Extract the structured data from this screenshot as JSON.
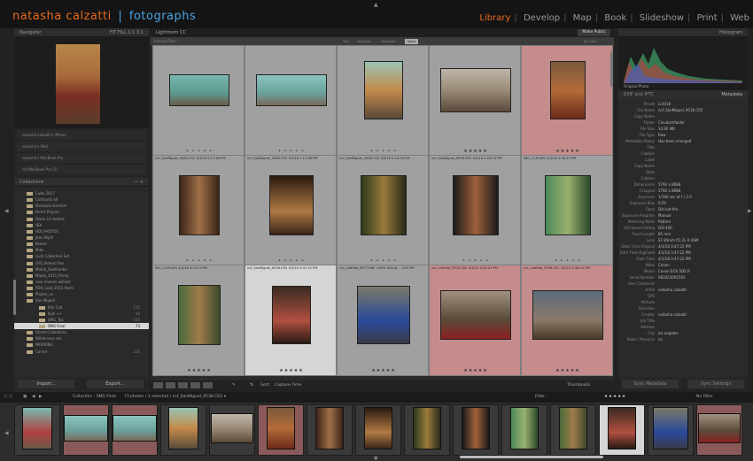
{
  "identity": {
    "brand_first": "natasha calzatti",
    "brand_separator": "|",
    "brand_second": "fotographs"
  },
  "modules": [
    "Library",
    "Develop",
    "Map",
    "Book",
    "Slideshow",
    "Print",
    "Web"
  ],
  "active_module": "Library",
  "navigator": {
    "title": "Navigator",
    "zoom_options": "FIT   FILL   1:1   3:1"
  },
  "publish": [
    "natasha calzatti's iPhone",
    "natasha's iPad",
    "natasha's MacBook Pro",
    "ncf MacBook Pro (2)"
  ],
  "collections": {
    "title": "Collections",
    "items": [
      {
        "name": "Cuba 2017",
        "count": ""
      },
      {
        "name": "Cultivarts olt",
        "count": ""
      },
      {
        "name": "Domaine Garmier",
        "count": ""
      },
      {
        "name": "Dvers Project",
        "count": ""
      },
      {
        "name": "Dwen Lil models",
        "count": ""
      },
      {
        "name": "HDI",
        "count": ""
      },
      {
        "name": "HDI_PHOTOS",
        "count": ""
      },
      {
        "name": "Jean Blyth",
        "count": ""
      },
      {
        "name": "Koerte",
        "count": ""
      },
      {
        "name": "Mike",
        "count": ""
      },
      {
        "name": "Loch Collection Set",
        "count": ""
      },
      {
        "name": "LRS_Videos files",
        "count": ""
      },
      {
        "name": "Mahdi_Seethimba",
        "count": ""
      },
      {
        "name": "Maple_2015_Primp",
        "count": ""
      },
      {
        "name": "new reverse william",
        "count": ""
      },
      {
        "name": "PDH_Look 2015 Posts",
        "count": ""
      },
      {
        "name": "Photos_sn",
        "count": ""
      },
      {
        "name": "San Miguel",
        "count": ""
      },
      {
        "name": "Kits Call",
        "count": "135"
      },
      {
        "name": "Kyle ++",
        "count": "48"
      },
      {
        "name": "SMG_Top",
        "count": "106"
      },
      {
        "name": "SMG Final",
        "count": "73"
      },
      {
        "name": "Street Collections",
        "count": ""
      },
      {
        "name": "Wilderness set",
        "count": ""
      },
      {
        "name": "WORKING",
        "count": ""
      },
      {
        "name": "Cornel",
        "count": "226"
      }
    ]
  },
  "buttons": {
    "import": "Import...",
    "export": "Export...",
    "make_public": "Make Public",
    "sync_metadata": "Sync Metadata",
    "sync_settings": "Sync Settings"
  },
  "center": {
    "title": "Lightroom CC",
    "filter_label": "Library Filter :",
    "filters": [
      "Text",
      "Attribute",
      "Metadata",
      "None"
    ],
    "active_filter": "None",
    "filter_preset": "No Filter"
  },
  "photos": [
    {
      "num": "",
      "file": "",
      "time": "",
      "stars": "•  •  •  •  •",
      "tone": "plain"
    },
    {
      "num": "",
      "file": "",
      "time": "",
      "stars": "•  •  •  •  •",
      "tone": "plain"
    },
    {
      "num": "",
      "file": "",
      "time": "",
      "stars": "•  •  •  •  •",
      "tone": "plain"
    },
    {
      "num": "",
      "file": "",
      "time": "",
      "stars": "★★★★★",
      "tone": "plain"
    },
    {
      "num": "",
      "file": "",
      "time": "",
      "stars": "★★★★★",
      "tone": "red"
    },
    {
      "num": "",
      "file": "ncf_SanMiguel_9464.CR2   4/3/18 2:17:46 PM",
      "time": "",
      "stars": "•  •  •  •  •",
      "tone": "plain"
    },
    {
      "num": "",
      "file": "ncf_SanMiguel_9464.CR2   4/3/18 2:17:48 PM",
      "time": "",
      "stars": "•  •  •  •  •",
      "tone": "plain"
    },
    {
      "num": "",
      "file": "ncf_SanMiguel_9498.CR2   4/3/18 2:24:34 PM",
      "time": "",
      "stars": "•  •  •  •  •",
      "tone": "plain"
    },
    {
      "num": "",
      "file": "ncf_SanMiguel_9508.CR2   4/3/18 2:25:14 PM",
      "time": "",
      "stars": "•  •  •  •  •",
      "tone": "plain"
    },
    {
      "num": "",
      "file": "IMG_1149.JPG   4/3/18 3:38:53 PM",
      "time": "",
      "stars": "•  •  •  •  •",
      "tone": "plain"
    },
    {
      "num": "",
      "file": "IMG_1199.JPG   4/3/18 3:20:52 PM",
      "time": "",
      "stars": "•  •  •  •  •",
      "tone": "plain"
    },
    {
      "num": "",
      "file": "ncf_SanMiguel_9538.CR2   4/3/18 3:47:22 PM",
      "time": "",
      "stars": "•  •  •  •  •",
      "tone": "white"
    },
    {
      "num": "",
      "file": "ncf_untitled_9077.RAF +JPEG   4/9/16 ... 200 PM",
      "time": "",
      "stars": "•  •  •  •  •",
      "tone": "plain"
    },
    {
      "num": "",
      "file": "ncf_untitled_9703.CR2   4/3/15 3:20:41 PM",
      "time": "",
      "stars": "•  •  •  •  •",
      "tone": "plain"
    },
    {
      "num": "",
      "file": "ncf_untitled_9796.CR2   4/3/15 3:38:10 PM",
      "time": "",
      "stars": "•  •  •  •  •",
      "tone": "plain"
    },
    {
      "num": "",
      "file": "",
      "time": "",
      "stars": "★★★★★",
      "tone": "plain"
    },
    {
      "num": "",
      "file": "",
      "time": "",
      "stars": "★★★★★",
      "tone": "white"
    },
    {
      "num": "",
      "file": "",
      "time": "",
      "stars": "★★★★★",
      "tone": "plain"
    },
    {
      "num": "",
      "file": "",
      "time": "",
      "stars": "★★★★★",
      "tone": "red"
    },
    {
      "num": "",
      "file": "",
      "time": "",
      "stars": "★★★★★",
      "tone": "red"
    }
  ],
  "toolbar": {
    "sort_label": "Sort:",
    "sort_value": "Capture Time",
    "thumbnails_label": "Thumbnails"
  },
  "histogram": {
    "title": "Histogram",
    "original_photo": "Original Photo"
  },
  "metadata": {
    "title": "Metadata",
    "preset_label": "EXIF and IPTC",
    "rows": [
      {
        "k": "Preset",
        "v": "Lr2018"
      },
      {
        "k": "File Name",
        "v": "ncf_SanMiguel_9538.CR2"
      },
      {
        "k": "Copy Name",
        "v": ""
      },
      {
        "k": "Folder",
        "v": "Cloudart/folder"
      },
      {
        "k": "File Size",
        "v": "33.92 MB"
      },
      {
        "k": "File Type",
        "v": "Raw"
      },
      {
        "k": "Metadata Status",
        "v": "Has been changed"
      },
      {
        "k": "Title",
        "v": ""
      },
      {
        "k": "Caption",
        "v": ""
      },
      {
        "k": "Label",
        "v": ""
      },
      {
        "k": "Copy Name",
        "v": ""
      },
      {
        "k": "Style",
        "v": ""
      },
      {
        "k": "Caption",
        "v": ""
      },
      {
        "k": "Dimensions",
        "v": "5792 x 8688"
      },
      {
        "k": "Cropped",
        "v": "5792 x 8688"
      },
      {
        "k": "Exposure",
        "v": "1/160 sec at f / 2.0"
      },
      {
        "k": "Exposure Bias",
        "v": "0 EV"
      },
      {
        "k": "Flash",
        "v": "Did not fire"
      },
      {
        "k": "Exposure Program",
        "v": "Manual"
      },
      {
        "k": "Metering Mode",
        "v": "Pattern"
      },
      {
        "k": "ISO Speed Rating",
        "v": "ISO 400"
      },
      {
        "k": "Focal Length",
        "v": "85 mm"
      },
      {
        "k": "Lens",
        "v": "EF 85mm f/1.2L II USM"
      },
      {
        "k": "Date Time Original",
        "v": "4/3/18 3:47:22 PM"
      },
      {
        "k": "Date Time Digitized",
        "v": "4/3/18 3:47:22 PM"
      },
      {
        "k": "Date Time",
        "v": "4/3/18 3:47:22 PM"
      },
      {
        "k": "Make",
        "v": "Canon"
      },
      {
        "k": "Model",
        "v": "Canon EOS 5DS R"
      },
      {
        "k": "Serial Number",
        "v": "082022001503"
      },
      {
        "k": "User Comment",
        "v": ""
      },
      {
        "k": "Artist",
        "v": "natasha calzatti"
      },
      {
        "k": "GPS",
        "v": ""
      },
      {
        "k": "Altitude",
        "v": ""
      },
      {
        "k": "Direction",
        "v": ""
      },
      {
        "k": "Creator",
        "v": "natasha calzatti"
      },
      {
        "k": "Job Title",
        "v": ""
      },
      {
        "k": "Address",
        "v": ""
      },
      {
        "k": "City",
        "v": "los angeles"
      },
      {
        "k": "State / Province",
        "v": "ca"
      }
    ]
  },
  "filmstrip": {
    "breadcrumb": "Collection : SMG Final",
    "info": "73 photos / 1 selected / ncf_SanMiguel_9538.CR2 ▾",
    "filter_label": "Filter :",
    "filter_value": "No Filter"
  },
  "colors": {
    "accent": "#e86a1c",
    "blue": "#4aa3e0",
    "selected": "#d6d6d6",
    "red_label": "#c58c8c"
  }
}
